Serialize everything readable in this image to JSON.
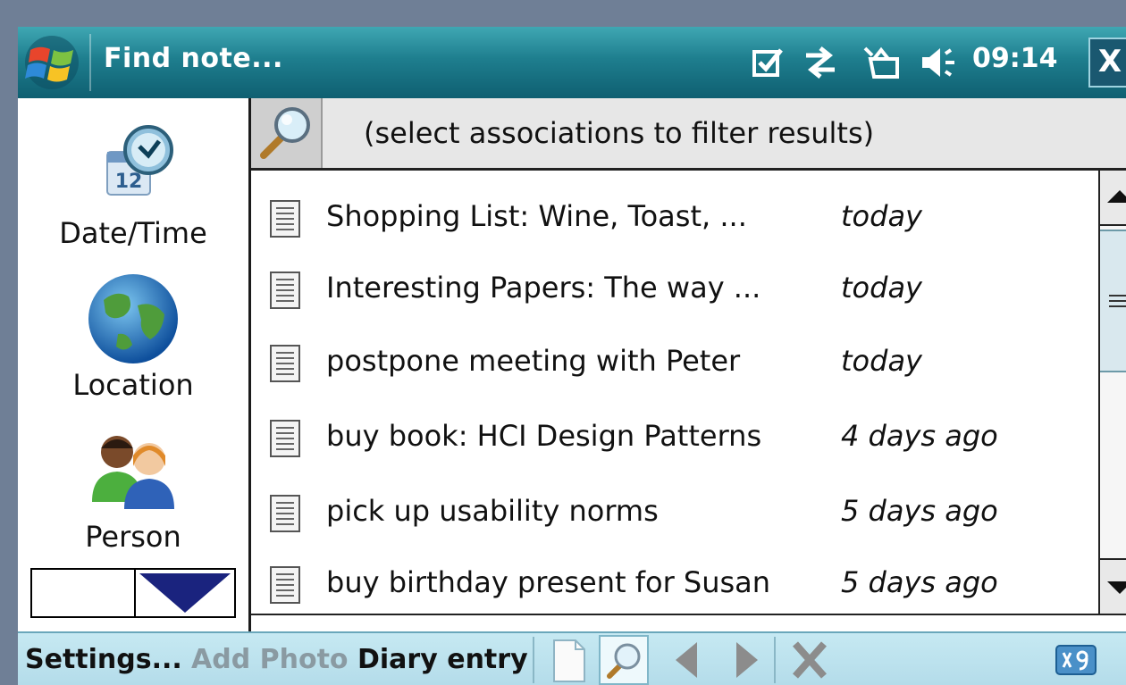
{
  "window": {
    "title": "Find note...",
    "clock": "09:14",
    "close_label": "X",
    "status_icons": [
      "checkbox-icon",
      "connectivity-icon",
      "signal-off-icon",
      "volume-icon"
    ]
  },
  "associations": {
    "items": [
      {
        "label": "Date/Time",
        "icon": "calendar-clock-icon"
      },
      {
        "label": "Location",
        "icon": "globe-icon"
      },
      {
        "label": "Person",
        "icon": "people-icon"
      }
    ]
  },
  "search": {
    "hint": "(select associations to filter results)"
  },
  "results": [
    {
      "title": "Shopping List: Wine, Toast, ...",
      "date": "today"
    },
    {
      "title": "Interesting Papers: The way ...",
      "date": "today"
    },
    {
      "title": "postpone meeting with Peter",
      "date": "today"
    },
    {
      "title": "buy book: HCI Design Patterns",
      "date": "4 days ago"
    },
    {
      "title": "pick up usability norms",
      "date": "5 days ago"
    },
    {
      "title": "buy birthday present for Susan",
      "date": "5 days ago"
    }
  ],
  "menu": {
    "settings": "Settings...",
    "add_photo": "Add Photo",
    "diary_entry": "Diary entry",
    "toolbar": [
      "new-note-icon",
      "search-icon",
      "back-icon",
      "forward-icon",
      "delete-icon"
    ]
  },
  "colors": {
    "titlebar": "#1e7e8e",
    "menubar": "#c6e9f2",
    "desktop": "#6f7f96",
    "disabled_text": "#8a9aa2",
    "selection_arrow": "#1a237e"
  }
}
